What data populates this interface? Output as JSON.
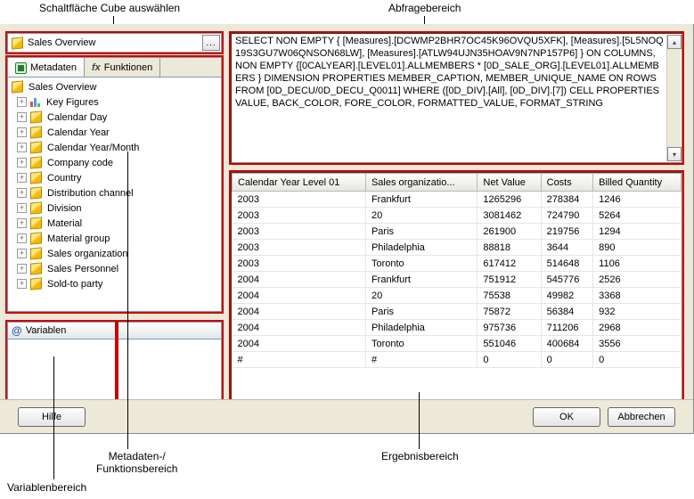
{
  "callouts": {
    "cubeButton": "Schaltfläche Cube auswählen",
    "queryArea": "Abfragebereich",
    "metaFunc": "Metadaten-/\nFunktionsbereich",
    "varArea": "Variablenbereich",
    "resultArea": "Ergebnisbereich"
  },
  "cubeSelector": {
    "label": "Sales Overview",
    "browseLabel": "..."
  },
  "tabs": {
    "metadata": "Metadaten",
    "functions": "Funktionen"
  },
  "tree": {
    "root": "Sales Overview",
    "children": [
      "Key Figures",
      "Calendar Day",
      "Calendar Year",
      "Calendar Year/Month",
      "Company code",
      "Country",
      "Distribution channel",
      "Division",
      "Material",
      "Material group",
      "Sales organization",
      "Sales Personnel",
      "Sold-to party"
    ]
  },
  "variables": {
    "header": "Variablen"
  },
  "queryText": "SELECT NON EMPTY { [Measures].[DCWMP2BHR7OC45K96OVQU5XFK], [Measures].[5L5NOQ19S3GU7W06QNSON68LW], [Measures].[ATLW94UJN35HOAV9N7NP157P6] } ON COLUMNS, NON EMPTY {[0CALYEAR].[LEVEL01].ALLMEMBERS * [0D_SALE_ORG].[LEVEL01].ALLMEMBERS } DIMENSION PROPERTIES MEMBER_CAPTION, MEMBER_UNIQUE_NAME ON ROWS FROM [0D_DECU/0D_DECU_Q0011] WHERE ([0D_DIV].[All], [0D_DIV].[7]) CELL PROPERTIES VALUE, BACK_COLOR, FORE_COLOR, FORMATTED_VALUE, FORMAT_STRING",
  "resultTable": {
    "columns": [
      "Calendar Year Level 01",
      "Sales organizatio...",
      "Net Value",
      "Costs",
      "Billed Quantity"
    ],
    "rows": [
      [
        "2003",
        "Frankfurt",
        "1265296",
        "278384",
        "1246"
      ],
      [
        "2003",
        "20",
        "3081462",
        "724790",
        "5264"
      ],
      [
        "2003",
        "Paris",
        "261900",
        "219756",
        "1294"
      ],
      [
        "2003",
        "Philadelphia",
        "88818",
        "3644",
        "890"
      ],
      [
        "2003",
        "Toronto",
        "617412",
        "514648",
        "1106"
      ],
      [
        "2004",
        "Frankfurt",
        "751912",
        "545776",
        "2526"
      ],
      [
        "2004",
        "20",
        "75538",
        "49982",
        "3368"
      ],
      [
        "2004",
        "Paris",
        "75872",
        "56384",
        "932"
      ],
      [
        "2004",
        "Philadelphia",
        "975736",
        "711206",
        "2968"
      ],
      [
        "2004",
        "Toronto",
        "551046",
        "400684",
        "3556"
      ],
      [
        "#",
        "#",
        "0",
        "0",
        "0"
      ]
    ]
  },
  "buttons": {
    "help": "Hilfe",
    "ok": "OK",
    "cancel": "Abbrechen"
  },
  "chart_data": {
    "type": "table",
    "columns": [
      "Calendar Year Level 01",
      "Sales organization",
      "Net Value",
      "Costs",
      "Billed Quantity"
    ],
    "rows": [
      [
        "2003",
        "Frankfurt",
        1265296,
        278384,
        1246
      ],
      [
        "2003",
        "20",
        3081462,
        724790,
        5264
      ],
      [
        "2003",
        "Paris",
        261900,
        219756,
        1294
      ],
      [
        "2003",
        "Philadelphia",
        88818,
        3644,
        890
      ],
      [
        "2003",
        "Toronto",
        617412,
        514648,
        1106
      ],
      [
        "2004",
        "Frankfurt",
        751912,
        545776,
        2526
      ],
      [
        "2004",
        "20",
        75538,
        49982,
        3368
      ],
      [
        "2004",
        "Paris",
        75872,
        56384,
        932
      ],
      [
        "2004",
        "Philadelphia",
        975736,
        711206,
        2968
      ],
      [
        "2004",
        "Toronto",
        551046,
        400684,
        3556
      ]
    ]
  }
}
